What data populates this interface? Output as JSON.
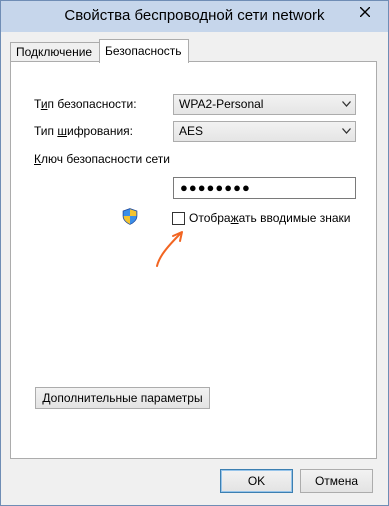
{
  "window": {
    "title": "Свойства беспроводной сети network"
  },
  "tabs": [
    {
      "label": "Подключение",
      "active": false
    },
    {
      "label": "Безопасность",
      "active": true
    }
  ],
  "security": {
    "type_label_pre": "Т",
    "type_label_u": "и",
    "type_label_post": "п безопасности:",
    "type_value": "WPA2-Personal",
    "encryption_label_pre": "Тип ",
    "encryption_label_u": "ш",
    "encryption_label_post": "ифрования:",
    "encryption_value": "AES",
    "key_label_pre": "",
    "key_label_u": "К",
    "key_label_post": "люч безопасности сети",
    "key_value": "●●●●●●●●",
    "show_chars_label_pre": "Отобра",
    "show_chars_label_u": "ж",
    "show_chars_label_post": "ать вводимые знаки",
    "show_chars_checked": false
  },
  "advanced_button": {
    "label_pre": "",
    "label_u": "Д",
    "label_post": "ополнительные параметры"
  },
  "footer": {
    "ok_label": "OK",
    "cancel_label": "Отмена"
  },
  "colors": {
    "annotation_arrow": "#f26522",
    "titlebar": "#c6d6eb"
  },
  "icons": {
    "shield": "uac-shield-icon",
    "close": "close-icon",
    "dropdown": "chevron-down-icon"
  }
}
